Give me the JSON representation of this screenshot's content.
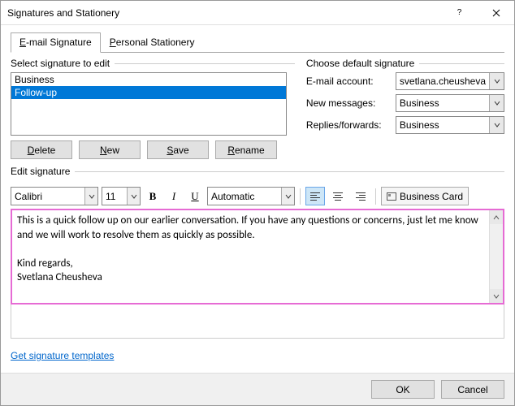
{
  "window": {
    "title": "Signatures and Stationery"
  },
  "tabs": {
    "email": "E-mail Signature",
    "stationery": "Personal Stationery"
  },
  "select_label": "Select signature to edit",
  "signatures": [
    "Business",
    "Follow-up"
  ],
  "buttons": {
    "delete": "Delete",
    "new": "New",
    "save": "Save",
    "rename": "Rename",
    "ok": "OK",
    "cancel": "Cancel",
    "business_card": "Business Card"
  },
  "default_section": {
    "title": "Choose default signature",
    "account_label": "E-mail account:",
    "account_value": "svetlana.cheusheva",
    "new_label": "New messages:",
    "new_value": "Business",
    "replies_label": "Replies/forwards:",
    "replies_value": "Business"
  },
  "edit_label": "Edit signature",
  "toolbar": {
    "font": "Calibri",
    "size": "11",
    "color": "Automatic"
  },
  "editor_body": "This is a quick follow up on our earlier conversation. If you have any questions or concerns, just let me know and we will work to resolve them as quickly as possible.\n\nKind regards,\nSvetlana Cheusheva",
  "link": "Get signature templates"
}
